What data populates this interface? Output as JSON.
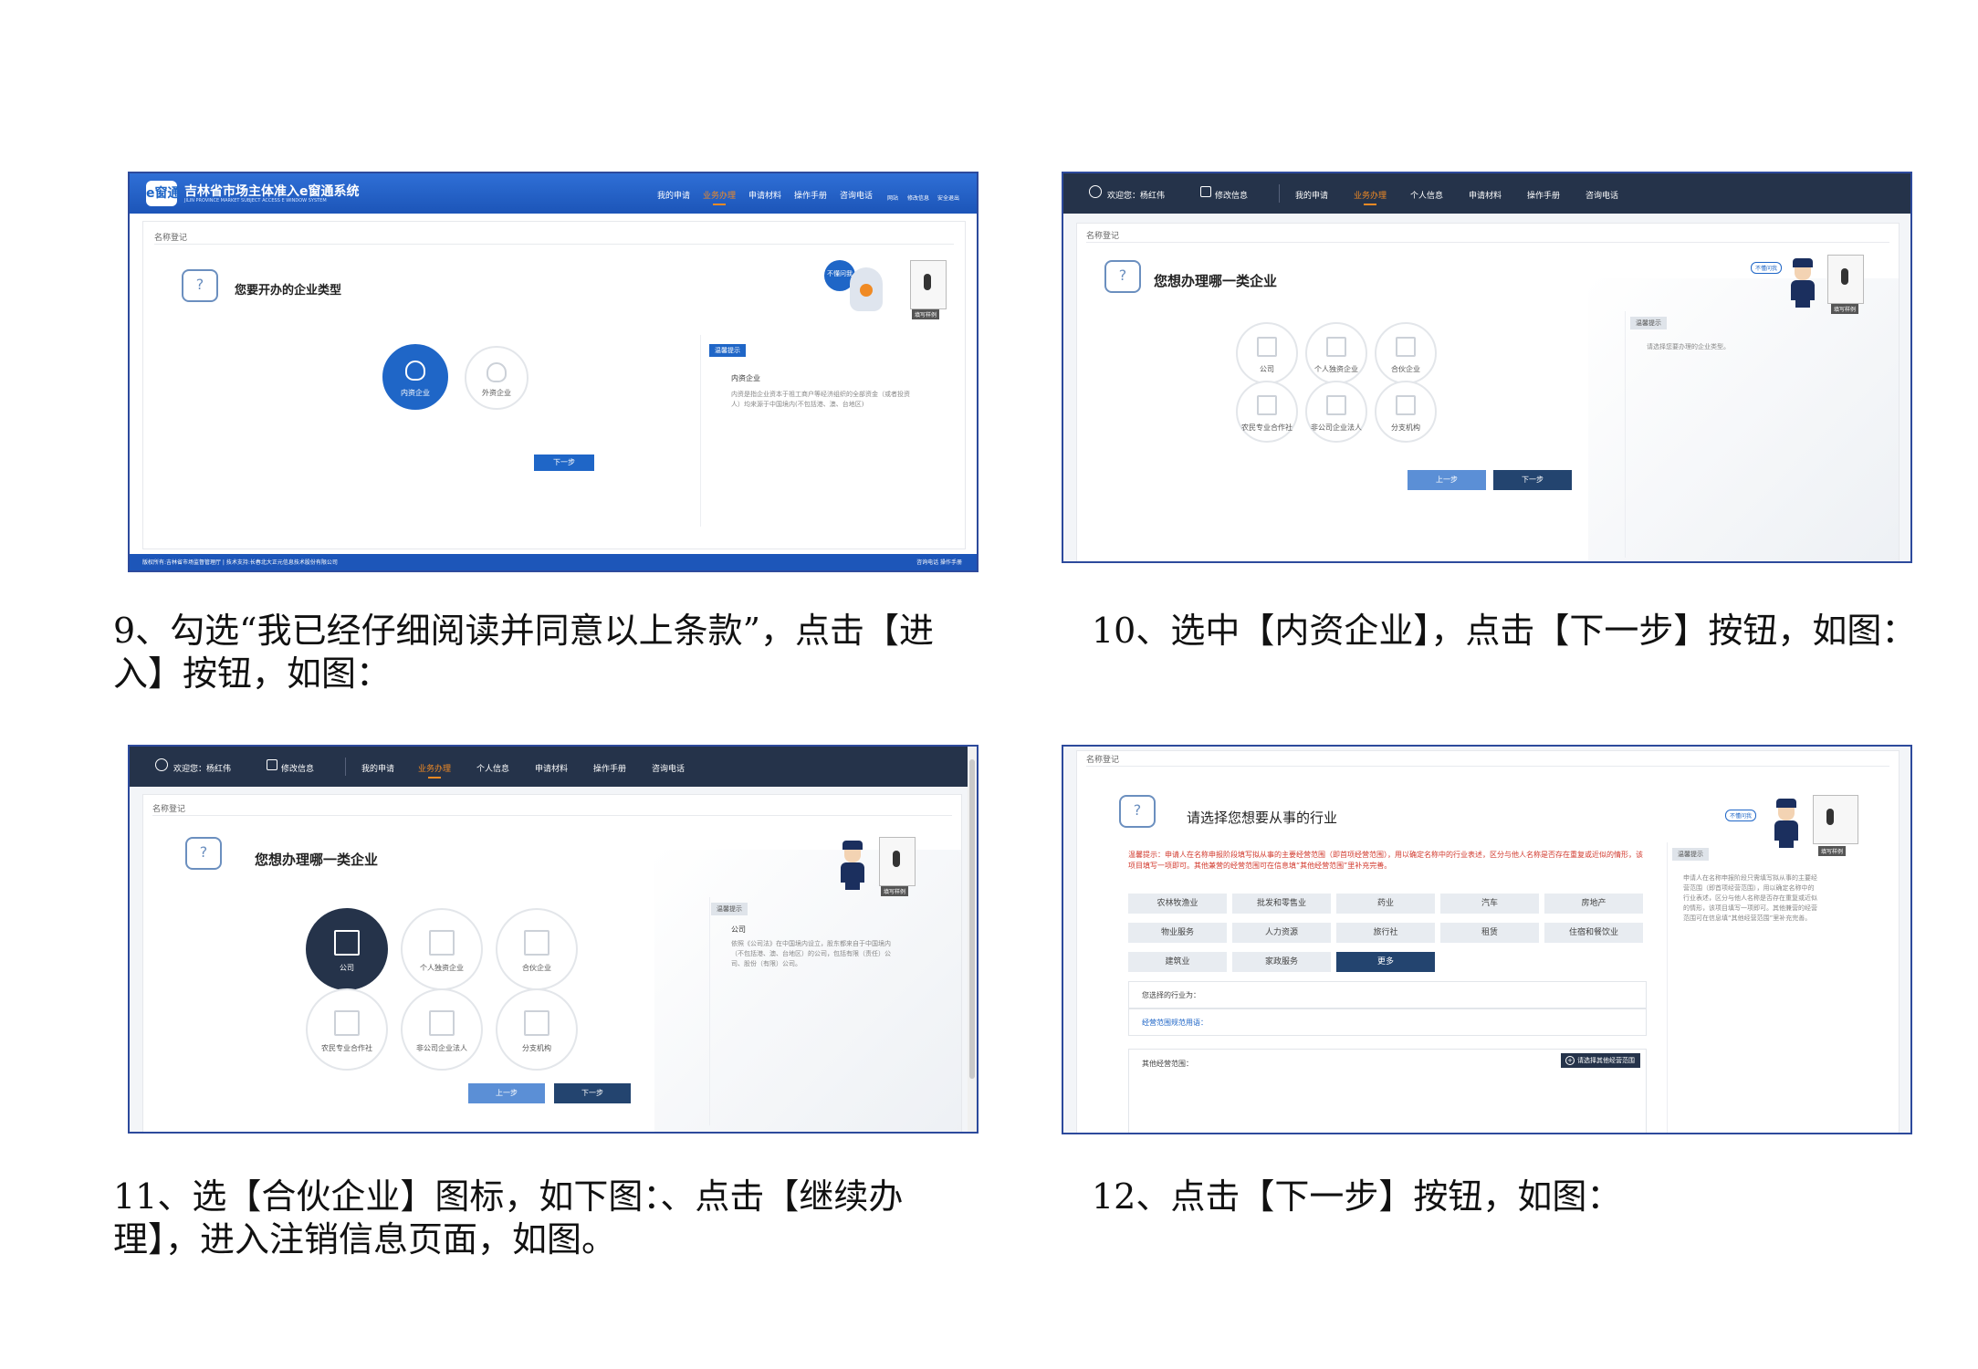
{
  "captions": {
    "cap9": "9、勾选“我已经仔细阅读并同意以上条款”，点击【进入】按钮，如图：",
    "cap10": "10、选中【内资企业】，点击【下一步】按钮，如图：",
    "cap11": "11、选【合伙企业】图标，如下图：、点击【继续办理】，进入注销信息页面，如图。",
    "cap12": "12、点击【下一步】按钮，如图："
  },
  "shot1": {
    "logo_text": "e窗通",
    "app_title": "吉林省市场主体准入e窗通系统",
    "app_subtitle": "JILIN PROVINCE MARKET SUBJECT ACCESS E WINDOW SYSTEM",
    "nav": [
      "我的申请",
      "业务办理",
      "申请材料",
      "操作手册",
      "咨询电话"
    ],
    "nav_active_index": 1,
    "right_icons": [
      "网站",
      "修改信息",
      "安全退出"
    ],
    "breadcrumb": "名称登记",
    "heading": "您要开办的企业类型",
    "options": [
      "内资企业",
      "外资企业"
    ],
    "selected": "内资企业",
    "robot_bubble": "不懂问我",
    "phone_label": "填写样例",
    "tip_tab": "温馨提示",
    "tip_title": "内资企业",
    "tip_body": "内资是指企业资本于祖工商户等经济组织的全部资金（或者投资人）均来源于中国境内(不包括港、澳、台地区)",
    "next_button": "下一步",
    "footer_left": "版权所有:吉林省市场监督管理厅 | 技术支持:长春北大正元信息技术股份有限公司",
    "footer_right": "咨询电话  操作手册"
  },
  "shot2": {
    "welcome": "欢迎您：杨红伟",
    "edit_info": "修改信息",
    "nav": [
      "我的申请",
      "业务办理",
      "个人信息",
      "申请材料",
      "操作手册",
      "咨询电话"
    ],
    "nav_active_index": 1,
    "breadcrumb": "名称登记",
    "heading": "您想办理哪一类企业",
    "options": [
      "公司",
      "个人独资企业",
      "合伙企业",
      "农民专业合作社",
      "非公司企业法人",
      "分支机构"
    ],
    "bubble": "不懂问我",
    "phone_label": "填写样例",
    "tip_tab": "温馨提示",
    "tip_body": "请选择您要办理的企业类型。",
    "prev_button": "上一步",
    "next_button": "下一步"
  },
  "shot3": {
    "welcome": "欢迎您：杨红伟",
    "edit_info": "修改信息",
    "nav": [
      "我的申请",
      "业务办理",
      "个人信息",
      "申请材料",
      "操作手册",
      "咨询电话"
    ],
    "nav_active_index": 1,
    "breadcrumb": "名称登记",
    "heading": "您想办理哪一类企业",
    "options": [
      "公司",
      "个人独资企业",
      "合伙企业",
      "农民专业合作社",
      "非公司企业法人",
      "分支机构"
    ],
    "selected": "公司",
    "phone_label": "填写样例",
    "tip_tab": "温馨提示",
    "tip_title": "公司",
    "tip_body": "依照《公司法》在中国境内设立，股东都来自于中国境内（不包括港、澳、台地区）的公司，包括有限（责任）公司、股份（有限）公司。",
    "prev_button": "上一步",
    "next_button": "下一步"
  },
  "shot4": {
    "breadcrumb": "名称登记",
    "heading": "请选择您想要从事的行业",
    "bubble": "不懂问我",
    "phone_label": "填写样例",
    "warning": "温馨提示：申请人在名称申报阶段填写拟从事的主要经营范围（即首项经营范围），用以确定名称中的行业表述，区分与他人名称是否存在重复或近似的情形，该项目填写一项即可。其他兼营的经营范围可在信息填“其他经营范围”里补充完善。",
    "industries": [
      "农林牧渔业",
      "批发和零售业",
      "药业",
      "汽车",
      "房地产",
      "物业服务",
      "人力资源",
      "旅行社",
      "租赁",
      "住宿和餐饮业",
      "建筑业",
      "家政服务",
      "更多"
    ],
    "active_industry": "更多",
    "selected_label": "您选择的行业为：",
    "standard_label": "经营范围规范用语：",
    "other_label": "其他经营范围：",
    "other_button": "请选择其他经营范围",
    "tip_tab": "温馨提示",
    "tip_body": "申请人在名称申报阶段只需填写拟从事的主要经营范围（即首项经营范围），用以确定名称中的行业表述，区分与他人名称是否存在重复或近似的情形，该项目填写一项即可。其他兼营的经营范围可在信息填“其他经营范围”里补充完善。"
  }
}
